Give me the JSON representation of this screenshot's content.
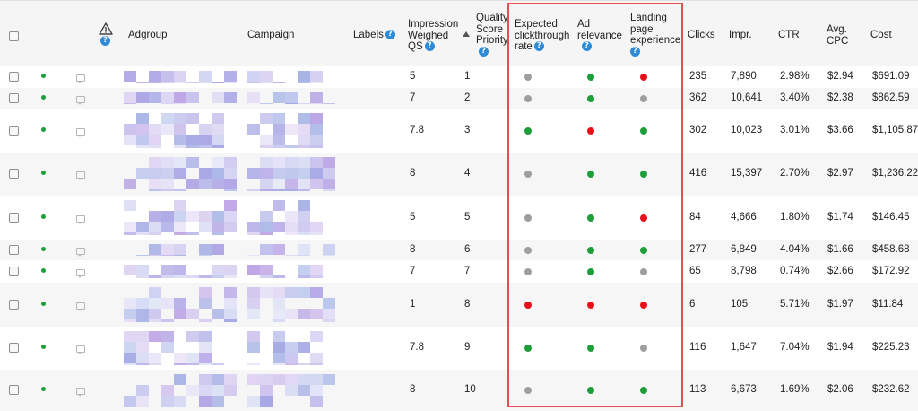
{
  "colors": {
    "header_bg": "#f5f5f5",
    "status_green": "#1e9e3a",
    "dot_green": "#1e9e3a",
    "dot_gray": "#9e9e9e",
    "dot_red": "#e8111a",
    "highlight_border": "#e35050",
    "help_blue": "#2e8bd8"
  },
  "header": {
    "adgroup": "Adgroup",
    "campaign": "Campaign",
    "labels": "Labels",
    "impression_qs": [
      "Impression",
      "Weighed",
      "QS"
    ],
    "quality_priority": [
      "Quality",
      "Score",
      "Priority"
    ],
    "expected_ctr": [
      "Expected",
      "clickthrough",
      "rate"
    ],
    "ad_relevance": [
      "Ad",
      "relevance"
    ],
    "landing_page": [
      "Landing",
      "page",
      "experience"
    ],
    "clicks": "Clicks",
    "impr": "Impr.",
    "ctr": "CTR",
    "avg_cpc": [
      "Avg.",
      "CPC"
    ],
    "cost": "Cost",
    "help_glyph": "?",
    "warning_icon": "warning-triangle-icon",
    "sort_icon": "sort-ascending-icon"
  },
  "rows": [
    {
      "qs": "5",
      "priority": "1",
      "exp_ctr": "gray",
      "ad_rel": "green",
      "landing": "red",
      "clicks": "235",
      "impr": "7,890",
      "ctr": "2.98%",
      "cpc": "$2.94",
      "cost": "$691.09"
    },
    {
      "qs": "7",
      "priority": "2",
      "exp_ctr": "gray",
      "ad_rel": "green",
      "landing": "gray",
      "clicks": "362",
      "impr": "10,641",
      "ctr": "3.40%",
      "cpc": "$2.38",
      "cost": "$862.59"
    },
    {
      "qs": "7.8",
      "priority": "3",
      "exp_ctr": "green",
      "ad_rel": "red",
      "landing": "green",
      "clicks": "302",
      "impr": "10,023",
      "ctr": "3.01%",
      "cpc": "$3.66",
      "cost": "$1,105.87"
    },
    {
      "qs": "8",
      "priority": "4",
      "exp_ctr": "gray",
      "ad_rel": "green",
      "landing": "green",
      "clicks": "416",
      "impr": "15,397",
      "ctr": "2.70%",
      "cpc": "$2.97",
      "cost": "$1,236.22"
    },
    {
      "qs": "5",
      "priority": "5",
      "exp_ctr": "gray",
      "ad_rel": "green",
      "landing": "red",
      "clicks": "84",
      "impr": "4,666",
      "ctr": "1.80%",
      "cpc": "$1.74",
      "cost": "$146.45"
    },
    {
      "qs": "8",
      "priority": "6",
      "exp_ctr": "gray",
      "ad_rel": "green",
      "landing": "green",
      "clicks": "277",
      "impr": "6,849",
      "ctr": "4.04%",
      "cpc": "$1.66",
      "cost": "$458.68"
    },
    {
      "qs": "7",
      "priority": "7",
      "exp_ctr": "gray",
      "ad_rel": "green",
      "landing": "gray",
      "clicks": "65",
      "impr": "8,798",
      "ctr": "0.74%",
      "cpc": "$2.66",
      "cost": "$172.92"
    },
    {
      "qs": "1",
      "priority": "8",
      "exp_ctr": "red",
      "ad_rel": "red",
      "landing": "red",
      "clicks": "6",
      "impr": "105",
      "ctr": "5.71%",
      "cpc": "$1.97",
      "cost": "$11.84"
    },
    {
      "qs": "7.8",
      "priority": "9",
      "exp_ctr": "green",
      "ad_rel": "green",
      "landing": "gray",
      "clicks": "116",
      "impr": "1,647",
      "ctr": "7.04%",
      "cpc": "$1.94",
      "cost": "$225.23"
    },
    {
      "qs": "8",
      "priority": "10",
      "exp_ctr": "gray",
      "ad_rel": "green",
      "landing": "green",
      "clicks": "113",
      "impr": "6,673",
      "ctr": "1.69%",
      "cpc": "$2.06",
      "cost": "$232.62"
    }
  ]
}
